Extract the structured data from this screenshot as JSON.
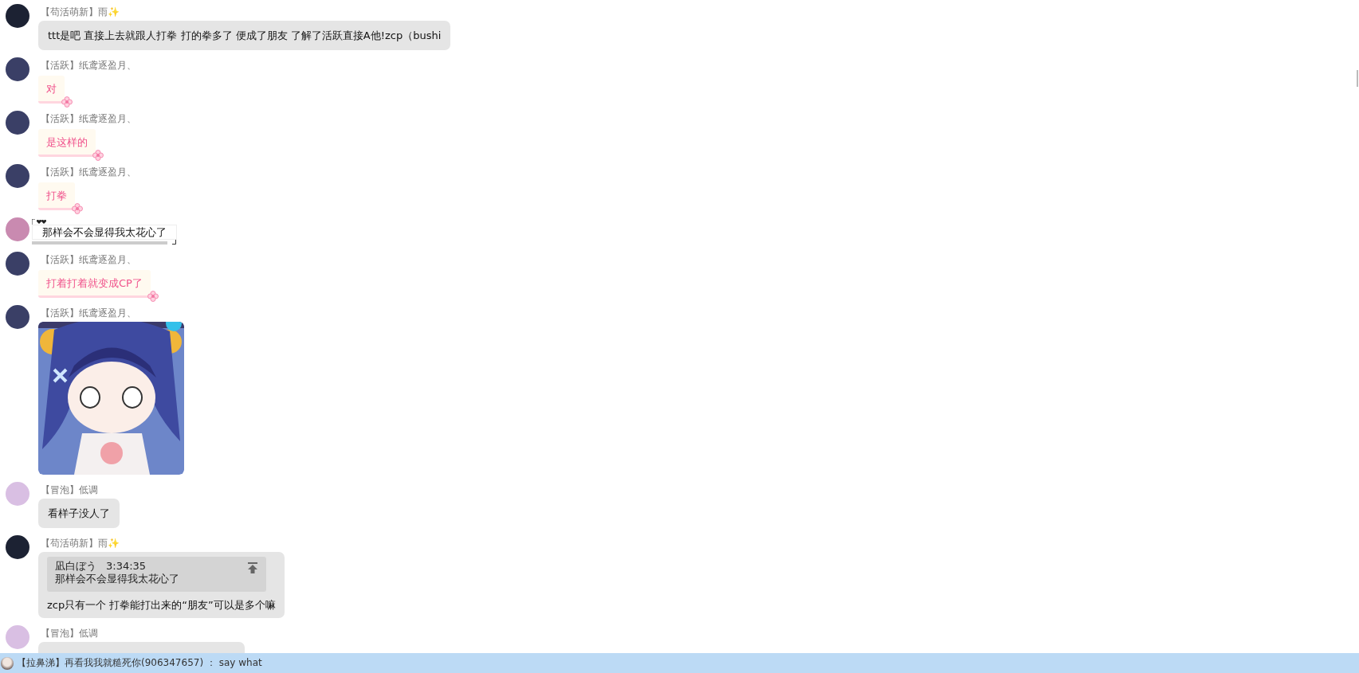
{
  "messages": [
    {
      "kind": "text",
      "color": "#1c2233",
      "name": "【苟活萌新】雨✨",
      "text": "ttt是吧 直接上去就跟人打拳 打的拳多了 便成了朋友 了解了活跃直接A他!zcp（bushi"
    },
    {
      "kind": "pink",
      "color": "#3a3f66",
      "name": "【活跃】纸鸢逐盈月、",
      "text": "对"
    },
    {
      "kind": "pink",
      "color": "#3a3f66",
      "name": "【活跃】纸鸢逐盈月、",
      "text": "是这样的"
    },
    {
      "kind": "pink",
      "color": "#3a3f66",
      "name": "【活跃】纸鸢逐盈月、",
      "text": "打拳"
    },
    {
      "kind": "bracket",
      "color": "#c98ab0",
      "text": "那样会不会显得我太花心了"
    },
    {
      "kind": "pink",
      "color": "#3a3f66",
      "name": "【活跃】纸鸢逐盈月、",
      "text": "打着打着就变成CP了"
    },
    {
      "color": "#3a3f66",
      "name": "【活跃】纸鸢逐盈月、"
    },
    {
      "kind": "text",
      "color": "#d9bfe3",
      "name": "【冒泡】低调",
      "text": "看样子没人了"
    },
    {
      "kind": "quote",
      "color": "#1c2233",
      "name": "【苟活萌新】雨✨",
      "quote_author": "凪白ぼう",
      "quote_time": "3:34:35",
      "quote_text": "那样会不会显得我太花心了",
      "text": "zcp只有一个 打拳能打出来的“朋友”可以是多个嘛"
    },
    {
      "kind": "partial",
      "color": "#d9bfe3",
      "name": "【冒泡】低调"
    }
  ],
  "notice": {
    "text": "【拉鼻涕】再看我我就糙死你(906347657) ： say what"
  }
}
